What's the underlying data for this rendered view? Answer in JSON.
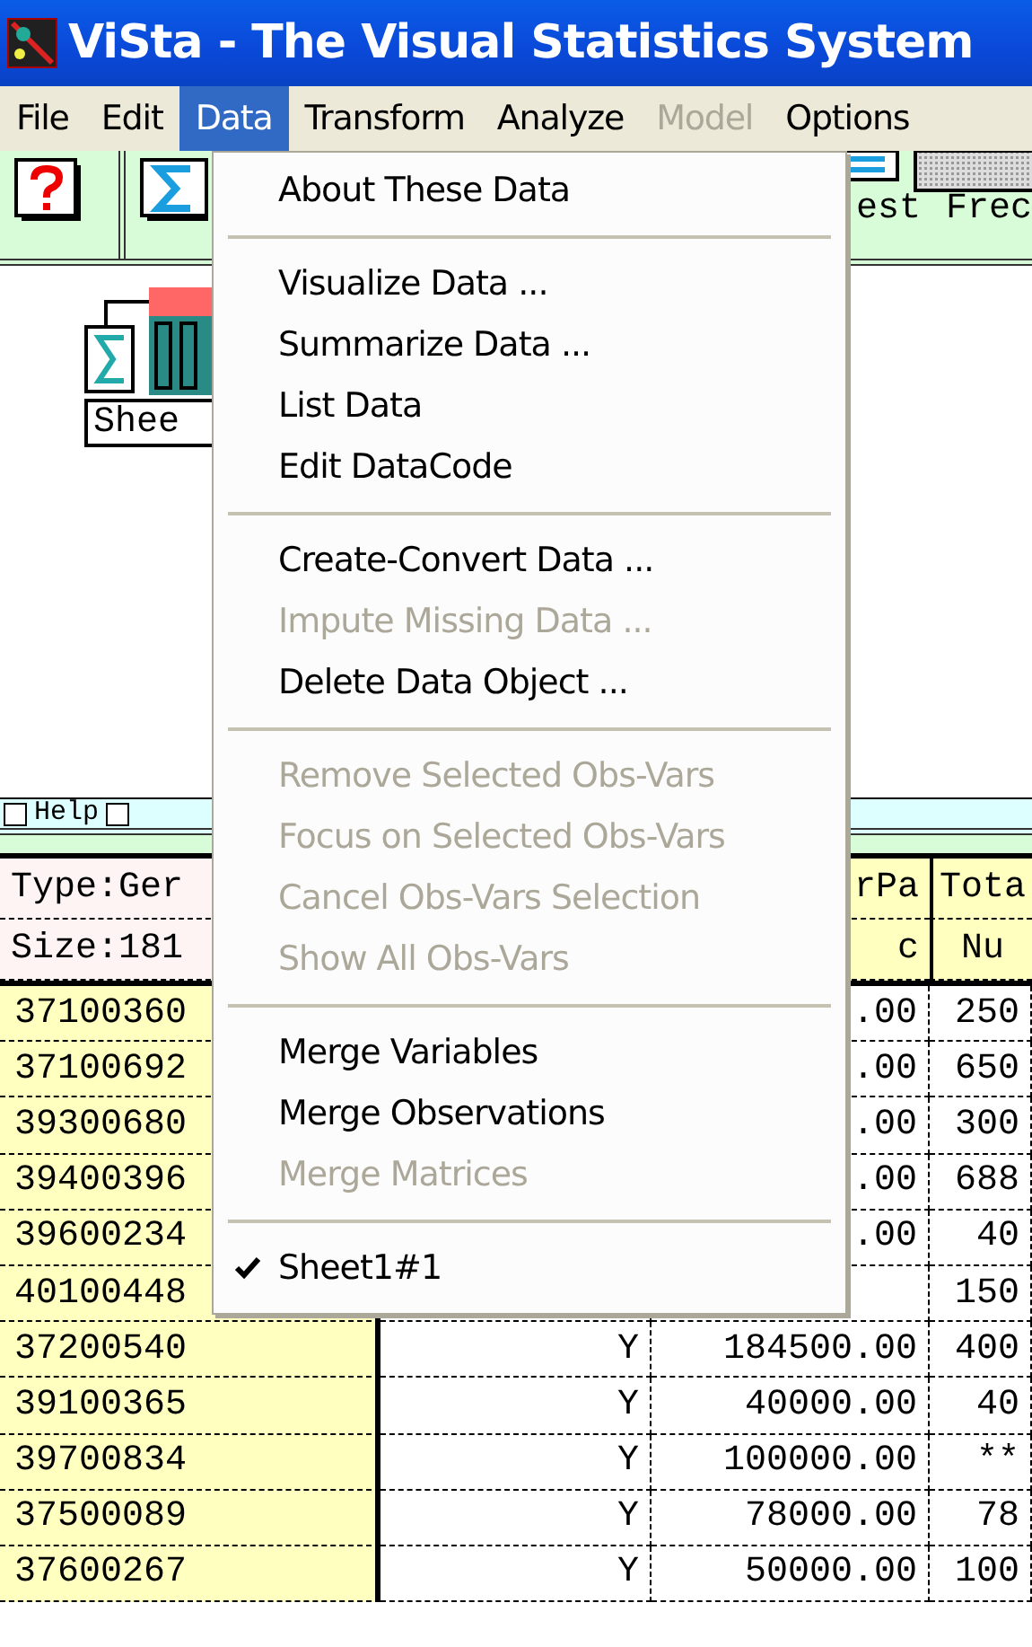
{
  "window": {
    "title": "ViSta - The Visual Statistics System"
  },
  "menubar": [
    {
      "label": "File",
      "selected": false,
      "disabled": false
    },
    {
      "label": "Edit",
      "selected": false,
      "disabled": false
    },
    {
      "label": "Data",
      "selected": true,
      "disabled": false
    },
    {
      "label": "Transform",
      "selected": false,
      "disabled": false
    },
    {
      "label": "Analyze",
      "selected": false,
      "disabled": false
    },
    {
      "label": "Model",
      "selected": false,
      "disabled": true
    },
    {
      "label": "Options",
      "selected": false,
      "disabled": false
    }
  ],
  "toolbar": {
    "labels": [
      "est",
      "Frec"
    ]
  },
  "workspace": {
    "object_label": "Shee"
  },
  "help_bar": {
    "label": "Help",
    "checked": false,
    "second_checked": false
  },
  "table": {
    "header_rows": [
      [
        "Type:Ger",
        "",
        "rPa",
        "Tota"
      ],
      [
        "Size:181",
        "",
        "c",
        "Nu"
      ]
    ],
    "rows": [
      [
        "37100360",
        "",
        ".00",
        "250"
      ],
      [
        "37100692",
        "",
        ".00",
        "650"
      ],
      [
        "39300680",
        "",
        ".00",
        "300"
      ],
      [
        "39400396",
        "",
        ".00",
        "688"
      ],
      [
        "39600234",
        "",
        ".00",
        "40"
      ],
      [
        "40100448",
        "",
        "",
        "150"
      ],
      [
        "37200540",
        "Y",
        "184500.00",
        "400"
      ],
      [
        "39100365",
        "Y",
        "40000.00",
        "40"
      ],
      [
        "39700834",
        "Y",
        "100000.00",
        "**"
      ],
      [
        "37500089",
        "Y",
        "78000.00",
        "78"
      ],
      [
        "37600267",
        "Y",
        "50000.00",
        "100"
      ]
    ]
  },
  "data_menu": [
    {
      "kind": "item",
      "label": "About These Data",
      "disabled": false,
      "checked": false
    },
    {
      "kind": "separator"
    },
    {
      "kind": "item",
      "label": "Visualize Data ...",
      "disabled": false,
      "checked": false
    },
    {
      "kind": "item",
      "label": "Summarize Data ...",
      "disabled": false,
      "checked": false
    },
    {
      "kind": "item",
      "label": "List Data",
      "disabled": false,
      "checked": false
    },
    {
      "kind": "item",
      "label": "Edit DataCode",
      "disabled": false,
      "checked": false
    },
    {
      "kind": "separator"
    },
    {
      "kind": "item",
      "label": "Create-Convert Data ...",
      "disabled": false,
      "checked": false
    },
    {
      "kind": "item",
      "label": "Impute Missing Data ...",
      "disabled": true,
      "checked": false
    },
    {
      "kind": "item",
      "label": "Delete Data Object ...",
      "disabled": false,
      "checked": false
    },
    {
      "kind": "separator"
    },
    {
      "kind": "item",
      "label": "Remove Selected Obs-Vars",
      "disabled": true,
      "checked": false
    },
    {
      "kind": "item",
      "label": "Focus on Selected Obs-Vars",
      "disabled": true,
      "checked": false
    },
    {
      "kind": "item",
      "label": "Cancel Obs-Vars Selection",
      "disabled": true,
      "checked": false
    },
    {
      "kind": "item",
      "label": "Show All Obs-Vars",
      "disabled": true,
      "checked": false
    },
    {
      "kind": "separator"
    },
    {
      "kind": "item",
      "label": "Merge Variables",
      "disabled": false,
      "checked": false
    },
    {
      "kind": "item",
      "label": "Merge Observations",
      "disabled": false,
      "checked": false
    },
    {
      "kind": "item",
      "label": "Merge Matrices",
      "disabled": true,
      "checked": false
    },
    {
      "kind": "separator"
    },
    {
      "kind": "item",
      "label": "Sheet1#1",
      "disabled": false,
      "checked": true
    }
  ]
}
